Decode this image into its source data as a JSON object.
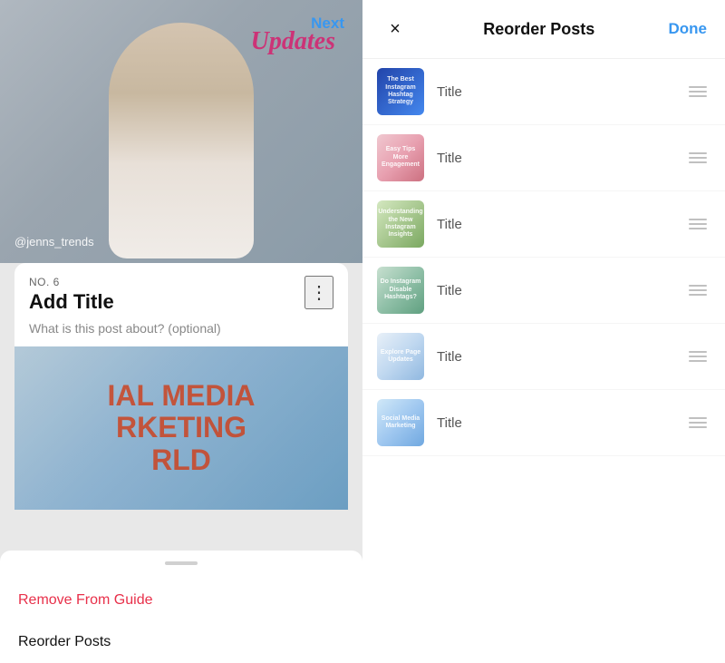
{
  "left": {
    "next_label": "Next",
    "watermark": "@jenns_trends",
    "updates_text": "Updates",
    "post": {
      "number": "NO. 6",
      "title": "Add Title",
      "description": "What is this post about? (optional)"
    },
    "bottom_sheet": {
      "remove_label": "Remove From Guide",
      "reorder_label": "Reorder Posts"
    },
    "mural_text": "IAL MEDIA\nRKETING\nRLD"
  },
  "right": {
    "close_icon": "×",
    "title": "Reorder Posts",
    "done_label": "Done",
    "posts": [
      {
        "id": 1,
        "title": "Title",
        "thumb_class": "thumb-1",
        "thumb_text": "The Best\nInstagram\nHashtag\nStrategy"
      },
      {
        "id": 2,
        "title": "Title",
        "thumb_class": "thumb-2",
        "thumb_text": "Easy Tips\nMore\nEngagement"
      },
      {
        "id": 3,
        "title": "Title",
        "thumb_class": "thumb-3",
        "thumb_text": "Understanding\nthe New\nInstagram\nInsights"
      },
      {
        "id": 4,
        "title": "Title",
        "thumb_class": "thumb-4",
        "thumb_text": "Do\nInstagram\nDisable\nHashtags?"
      },
      {
        "id": 5,
        "title": "Title",
        "thumb_class": "thumb-5",
        "thumb_text": "Explore\nPage\nUpdates"
      },
      {
        "id": 6,
        "title": "Title",
        "thumb_class": "thumb-6",
        "thumb_text": "Social\nMedia\nMarketing"
      }
    ]
  }
}
